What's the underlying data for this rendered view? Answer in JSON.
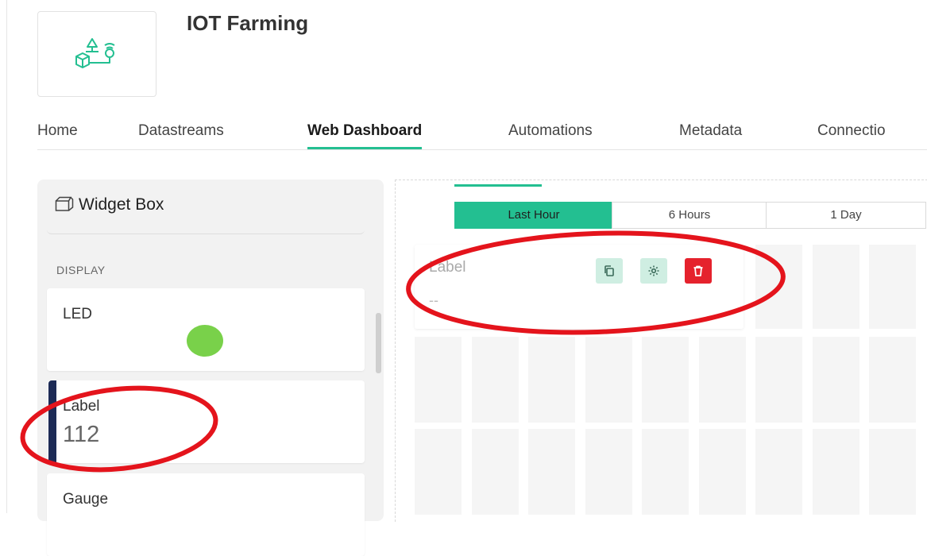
{
  "app": {
    "title": "IOT Farming"
  },
  "tabs": [
    {
      "label": "Home"
    },
    {
      "label": "Datastreams"
    },
    {
      "label": "Web Dashboard",
      "active": true
    },
    {
      "label": "Automations"
    },
    {
      "label": "Metadata"
    },
    {
      "label": "Connectio"
    }
  ],
  "widget_box": {
    "title": "Widget Box",
    "section": "DISPLAY",
    "widgets": [
      {
        "title": "LED",
        "icon": "led-dot-icon",
        "color": "#79d14a"
      },
      {
        "title": "Label",
        "value": "112",
        "accent": "#1d2b56"
      },
      {
        "title": "Gauge"
      }
    ]
  },
  "dashboard": {
    "time_range": [
      {
        "label": "Last Hour",
        "active": true
      },
      {
        "label": "6 Hours"
      },
      {
        "label": "1 Day"
      }
    ],
    "label_widget": {
      "title": "Label",
      "value": "--",
      "actions": [
        "copy-icon",
        "gear-icon",
        "trash-icon"
      ]
    }
  },
  "colors": {
    "accent": "#23bf91",
    "danger": "#e5222d",
    "annotation": "#e4141c"
  }
}
